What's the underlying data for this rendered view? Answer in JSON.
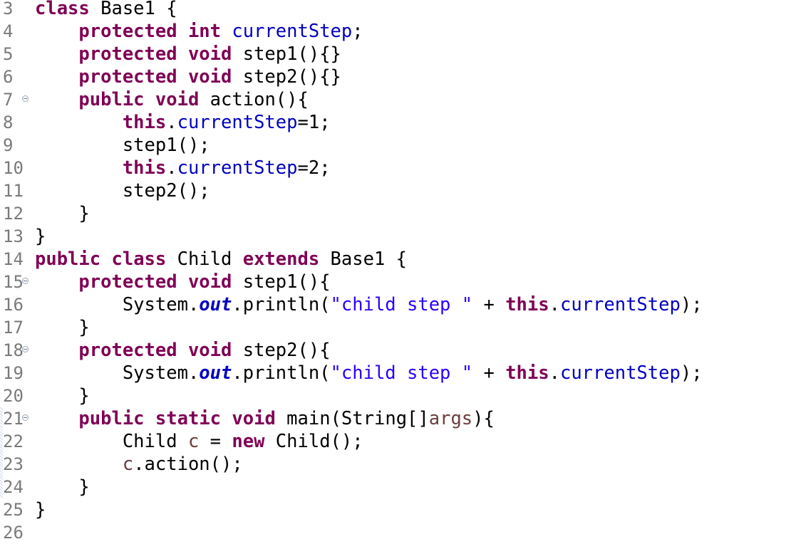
{
  "editor": {
    "lines": [
      {
        "num": "3",
        "fold": false,
        "indent": "",
        "tokens": [
          [
            "kw",
            "class"
          ],
          [
            "plain",
            " Base1 {"
          ]
        ]
      },
      {
        "num": "4",
        "fold": false,
        "indent": "    ",
        "tokens": [
          [
            "kw",
            "protected"
          ],
          [
            "plain",
            " "
          ],
          [
            "kw",
            "int"
          ],
          [
            "plain",
            " "
          ],
          [
            "fld",
            "currentStep"
          ],
          [
            "plain",
            ";"
          ]
        ]
      },
      {
        "num": "5",
        "fold": false,
        "indent": "    ",
        "tokens": [
          [
            "kw",
            "protected"
          ],
          [
            "plain",
            " "
          ],
          [
            "kw",
            "void"
          ],
          [
            "plain",
            " step1(){}"
          ]
        ]
      },
      {
        "num": "6",
        "fold": false,
        "indent": "    ",
        "tokens": [
          [
            "kw",
            "protected"
          ],
          [
            "plain",
            " "
          ],
          [
            "kw",
            "void"
          ],
          [
            "plain",
            " step2(){}"
          ]
        ]
      },
      {
        "num": "7",
        "fold": true,
        "indent": "    ",
        "tokens": [
          [
            "kw",
            "public"
          ],
          [
            "plain",
            " "
          ],
          [
            "kw",
            "void"
          ],
          [
            "plain",
            " action(){"
          ]
        ]
      },
      {
        "num": "8",
        "fold": false,
        "indent": "        ",
        "tokens": [
          [
            "kw",
            "this"
          ],
          [
            "plain",
            "."
          ],
          [
            "fld",
            "currentStep"
          ],
          [
            "plain",
            "=1;"
          ]
        ]
      },
      {
        "num": "9",
        "fold": false,
        "indent": "        ",
        "tokens": [
          [
            "plain",
            "step1();"
          ]
        ]
      },
      {
        "num": "10",
        "fold": false,
        "indent": "        ",
        "tokens": [
          [
            "kw",
            "this"
          ],
          [
            "plain",
            "."
          ],
          [
            "fld",
            "currentStep"
          ],
          [
            "plain",
            "=2;"
          ]
        ]
      },
      {
        "num": "11",
        "fold": false,
        "indent": "        ",
        "tokens": [
          [
            "plain",
            "step2();"
          ]
        ]
      },
      {
        "num": "12",
        "fold": false,
        "indent": "    ",
        "tokens": [
          [
            "plain",
            "}"
          ]
        ]
      },
      {
        "num": "13",
        "fold": false,
        "indent": "",
        "tokens": [
          [
            "plain",
            "}"
          ]
        ]
      },
      {
        "num": "14",
        "fold": false,
        "indent": "",
        "tokens": [
          [
            "kw",
            "public"
          ],
          [
            "plain",
            " "
          ],
          [
            "kw",
            "class"
          ],
          [
            "plain",
            " Child "
          ],
          [
            "kw",
            "extends"
          ],
          [
            "plain",
            " Base1 {"
          ]
        ]
      },
      {
        "num": "15",
        "fold": true,
        "indent": "    ",
        "tokens": [
          [
            "kw",
            "protected"
          ],
          [
            "plain",
            " "
          ],
          [
            "kw",
            "void"
          ],
          [
            "plain",
            " step1(){"
          ]
        ]
      },
      {
        "num": "16",
        "fold": false,
        "indent": "        ",
        "tokens": [
          [
            "plain",
            "System."
          ],
          [
            "static",
            "out"
          ],
          [
            "plain",
            ".println("
          ],
          [
            "str",
            "\"child step \""
          ],
          [
            "plain",
            " + "
          ],
          [
            "kw",
            "this"
          ],
          [
            "plain",
            "."
          ],
          [
            "fld",
            "currentStep"
          ],
          [
            "plain",
            ");"
          ]
        ]
      },
      {
        "num": "17",
        "fold": false,
        "indent": "    ",
        "tokens": [
          [
            "plain",
            "}"
          ]
        ]
      },
      {
        "num": "18",
        "fold": true,
        "indent": "    ",
        "tokens": [
          [
            "kw",
            "protected"
          ],
          [
            "plain",
            " "
          ],
          [
            "kw",
            "void"
          ],
          [
            "plain",
            " step2(){"
          ]
        ]
      },
      {
        "num": "19",
        "fold": false,
        "indent": "        ",
        "tokens": [
          [
            "plain",
            "System."
          ],
          [
            "static",
            "out"
          ],
          [
            "plain",
            ".println("
          ],
          [
            "str",
            "\"child step \""
          ],
          [
            "plain",
            " + "
          ],
          [
            "kw",
            "this"
          ],
          [
            "plain",
            "."
          ],
          [
            "fld",
            "currentStep"
          ],
          [
            "plain",
            ");"
          ]
        ]
      },
      {
        "num": "20",
        "fold": false,
        "indent": "    ",
        "tokens": [
          [
            "plain",
            "}"
          ]
        ]
      },
      {
        "num": "21",
        "fold": true,
        "indent": "    ",
        "tokens": [
          [
            "kw",
            "public"
          ],
          [
            "plain",
            " "
          ],
          [
            "kw",
            "static"
          ],
          [
            "plain",
            " "
          ],
          [
            "kw",
            "void"
          ],
          [
            "plain",
            " main(String[]"
          ],
          [
            "var",
            "args"
          ],
          [
            "plain",
            "){"
          ]
        ]
      },
      {
        "num": "22",
        "fold": false,
        "indent": "        ",
        "tokens": [
          [
            "plain",
            "Child "
          ],
          [
            "var",
            "c"
          ],
          [
            "plain",
            " = "
          ],
          [
            "kw",
            "new"
          ],
          [
            "plain",
            " Child();"
          ]
        ]
      },
      {
        "num": "23",
        "fold": false,
        "indent": "        ",
        "tokens": [
          [
            "var",
            "c"
          ],
          [
            "plain",
            ".action();"
          ]
        ]
      },
      {
        "num": "24",
        "fold": false,
        "indent": "    ",
        "tokens": [
          [
            "plain",
            "}"
          ]
        ]
      },
      {
        "num": "25",
        "fold": false,
        "indent": "",
        "tokens": [
          [
            "plain",
            "}"
          ]
        ]
      },
      {
        "num": "26",
        "fold": false,
        "indent": "",
        "tokens": []
      }
    ],
    "colors": {
      "keyword": "#7f0055",
      "field": "#0000c0",
      "string": "#2a00ff",
      "line_number": "#7a7a7a",
      "background": "#ffffff"
    }
  }
}
